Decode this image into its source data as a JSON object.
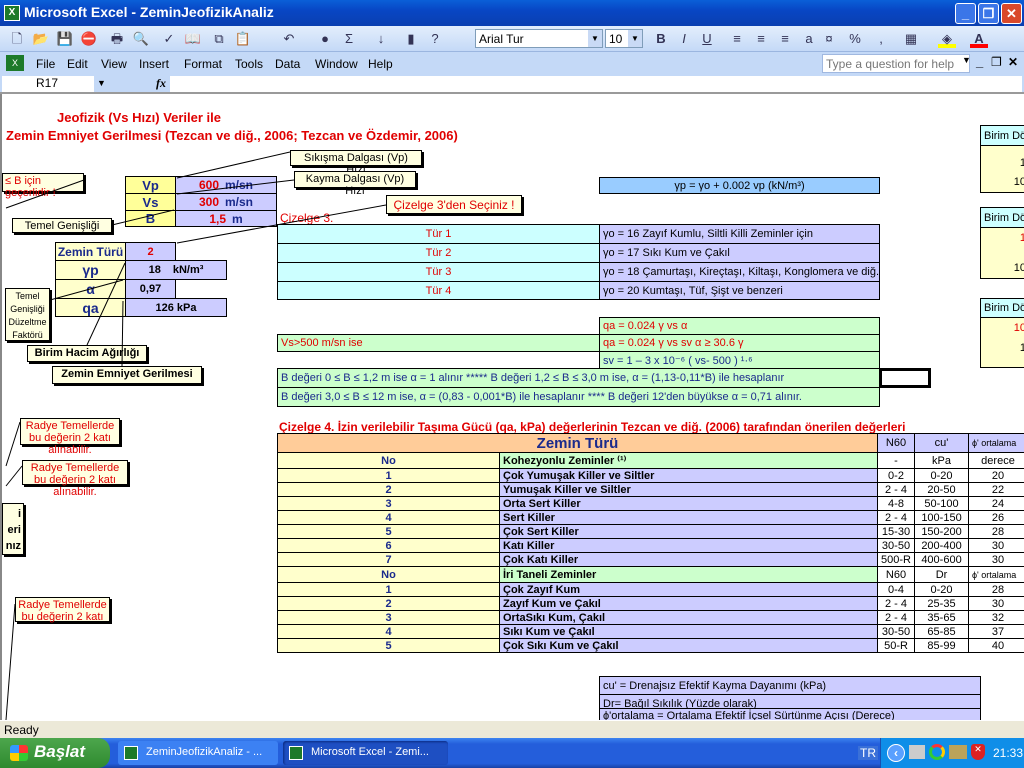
{
  "window": {
    "title": "Microsoft Excel - ZeminJeofizikAnaliz",
    "app_icon": "excel-icon"
  },
  "toolbar": {
    "font": "Arial Tur",
    "size": "10",
    "icons": [
      "new-icon",
      "open-icon",
      "save-icon",
      "permission-icon",
      "print-icon",
      "print-preview-icon",
      "spelling-icon",
      "research-icon",
      "copy-icon",
      "paste-icon",
      "undo-icon",
      "hyperlink-icon",
      "autosum-icon",
      "sort-icon",
      "chart-wizard-icon",
      "help-icon",
      "bold-icon",
      "italic-icon",
      "underline-icon",
      "align-left-icon",
      "center-icon",
      "align-right-icon",
      "merge-icon",
      "currency-icon",
      "percent-icon",
      "comma-icon",
      "borders-icon",
      "fill-color-icon",
      "font-color-icon"
    ],
    "fill_color": "#ffff00",
    "font_color": "#ff0000"
  },
  "menu": {
    "items": [
      "File",
      "Edit",
      "View",
      "Insert",
      "Format",
      "Tools",
      "Data",
      "Window",
      "Help"
    ],
    "help_placeholder": "Type a question for help"
  },
  "formula": {
    "name_box": "R17",
    "fx": "fx",
    "value": ""
  },
  "sheet": {
    "title1": "Jeofizik (Vs Hızı) Veriler ile",
    "title2": "Zemin Emniyet Gerilmesi  (Tezcan ve diğ., 2006; Tezcan ve Özdemir, 2006)",
    "inputs": [
      {
        "label": "Vp",
        "value": "600",
        "unit": "m/sn"
      },
      {
        "label": "Vs",
        "value": "300",
        "unit": "m/sn"
      },
      {
        "label": "B",
        "value": "1,5",
        "unit": "m"
      }
    ],
    "results": [
      {
        "label": "Zemin Türü",
        "value": "2",
        "unit": ""
      },
      {
        "label": "γp",
        "value": "18",
        "unit": "kN/m³"
      },
      {
        "label": "α",
        "value": "0,97",
        "unit": ""
      },
      {
        "label": "qa",
        "value": "126  kPa",
        "unit": ""
      }
    ],
    "notes": {
      "vp": "Sıkışma Dalgası (Vp) Hızı",
      "vs": "Kayma Dalgası (Vp) Hızı",
      "b_valid": "≤ B için geçerlidir !",
      "cizelge3_select": "Çizelge 3'den Seçiniz !",
      "temel": "Temel Genişliği",
      "alpha": "Temel Genişliği Düzeltme Faktörü",
      "gamma": "Birim Hacim Ağırlığı",
      "qa": "Zemin Emniyet Gerilmesi",
      "radye1": "Radye Temellerde bu değerin 2 katı alınabilir.",
      "radye2": "Radye Temellerde bu değerin 2 katı alınabilir.",
      "partial": "i\neri\nnız",
      "radye3": "Radye Temellerde bu değerin 2 katı"
    },
    "gamma_formula": "γp  =  γo +  0.002  vp      (kN/m³)",
    "cizelge3_label": "Çizelge 3.",
    "tur_rows": [
      {
        "tur": "Tür 1",
        "desc": "γo = 16   Zayıf Kumlu, Siltli Killi Zeminler için"
      },
      {
        "tur": "Tür 2",
        "desc": "γo = 17   Sıkı Kum ve Çakıl"
      },
      {
        "tur": "Tür 3",
        "desc": "γo = 18   Çamurtaşı, Kireçtaşı, Kiltaşı, Konglomera ve diğ."
      },
      {
        "tur": "Tür 4",
        "desc": "γo = 20   Kumtaşı, Tüf, Şişt ve benzeri"
      }
    ],
    "qa_formula1": "qa = 0.024 γ  vs α",
    "vs_condition": "Vs>500 m/sn ise",
    "qa_formula2": "qa = 0.024 γ  vs  sv  α  ≥  30.6 γ",
    "sv_formula": "sv = 1 – 3 x 10⁻⁶ ( vs- 500 ) ¹·⁶",
    "alpha_rule1": "B değeri 0 ≤ B ≤ 1,2 m ise α = 1 alınır  *****  B değeri 1,2 ≤ B ≤ 3,0 m ise,  α = (1,13-0,11*B) ile hesaplanır",
    "alpha_rule2": "B değeri 3,0 ≤ B ≤ 12 m ise,  α = (0,83 - 0,001*B) ile hesaplanır **** B değeri 12'den büyükse  α = 0,71 alınır.",
    "right_boxes": [
      {
        "header": "Birim Döm",
        "values": [
          "",
          "1",
          "10"
        ]
      },
      {
        "header": "Birim Döm",
        "values": [
          "1",
          "",
          "10"
        ]
      },
      {
        "header": "Birim Döm",
        "values": [
          "10",
          "1",
          ""
        ]
      }
    ],
    "cizelge4": {
      "title": "Çizelge 4. İzin verilebilir Taşıma Gücü (qa, kPa) değerlerinin Tezcan ve diğ. (2006) tarafından önerilen değerleri",
      "header": {
        "zemin": "Zemin Türü",
        "n60": "N60",
        "cu": "cu'",
        "phi": "ϕ' ortalama"
      },
      "groups": [
        {
          "no": "No",
          "name": "Kohezyonlu Zeminler ⁽¹⁾",
          "n60": "-",
          "cu": "kPa",
          "phi": "derece",
          "rows": [
            [
              "1",
              "Çok Yumuşak Killer ve Siltler",
              "0-2",
              "0-20",
              "20"
            ],
            [
              "2",
              "Yumuşak Killer ve Siltler",
              "2 - 4",
              "20-50",
              "22"
            ],
            [
              "3",
              "Orta Sert Killer",
              "4-8",
              "50-100",
              "24"
            ],
            [
              "4",
              "Sert Killer",
              "2 - 4",
              "100-150",
              "26"
            ],
            [
              "5",
              "Çok Sert Killer",
              "15-30",
              "150-200",
              "28"
            ],
            [
              "6",
              "Katı Killer",
              "30-50",
              "200-400",
              "30"
            ],
            [
              "7",
              "Çok Katı Killer",
              "500-R",
              "400-600",
              "30"
            ]
          ]
        },
        {
          "no": "No",
          "name": "İri Taneli Zeminler",
          "n60": "N60",
          "cu": "Dr",
          "phi": "ϕ' ortalama",
          "rows": [
            [
              "1",
              "Çok Zayıf Kum",
              "0-4",
              "0-20",
              "28"
            ],
            [
              "2",
              "Zayıf Kum ve Çakıl",
              "2 - 4",
              "25-35",
              "30"
            ],
            [
              "3",
              "OrtaSıkı Kum, Çakıl",
              "2 - 4",
              "35-65",
              "32"
            ],
            [
              "4",
              "Sıkı Kum ve Çakıl",
              "30-50",
              "65-85",
              "37"
            ],
            [
              "5",
              "Çok Sıkı Kum ve Çakıl",
              "50-R",
              "85-99",
              "40"
            ]
          ]
        }
      ]
    },
    "legend": [
      "cu' = Drenajsız Efektif Kayma Dayanımı (kPa)",
      "Dr= Bağıl Sıkılık (Yüzde olarak)",
      "ϕ'ortalama = Ortalama Efektif İçsel Sürtünme Açısı (Derece)"
    ],
    "selected_cell": "R17"
  },
  "status": {
    "text": "Ready"
  },
  "taskbar": {
    "start": "Başlat",
    "tasks": [
      "ZeminJeofizikAnaliz - ...",
      "Microsoft Excel - Zemi..."
    ],
    "lang": "TR",
    "time": "21:33"
  },
  "colors": {
    "title_red": "#e00000",
    "navy": "#1a2a8c",
    "yellow": "#ffffcc",
    "lavender": "#ccccff",
    "cyan": "#ccffff",
    "green": "#ccffcc",
    "blue": "#99ccff",
    "orange": "#ffcc99"
  }
}
